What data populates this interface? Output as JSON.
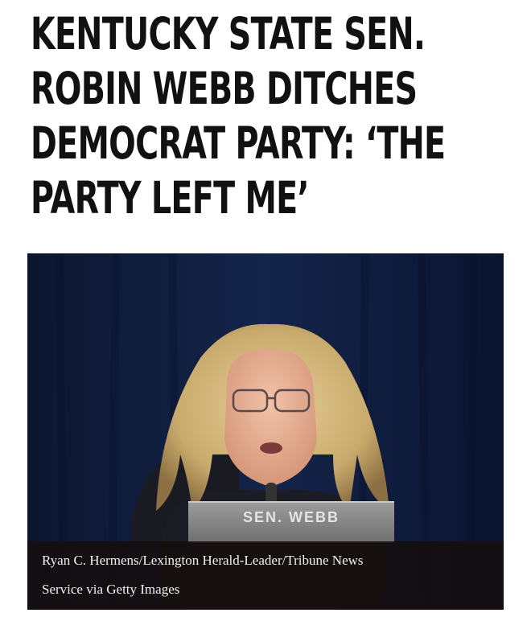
{
  "article": {
    "headline_lines": [
      "KENTUCKY STATE SEN.",
      "ROBIN WEBB DITCHES",
      "DEMOCRAT PARTY: ‘THE",
      "PARTY LEFT ME’"
    ]
  },
  "photo": {
    "nameplate": "SEN. WEBB",
    "caption_lines": [
      "Ryan C. Hermens/Lexington Herald-Leader/Tribune News",
      "Service via Getty Images"
    ]
  },
  "colors": {
    "headline_text": "#111111",
    "background_curtain": "#0f1a33",
    "caption_bar": "#140e0e"
  }
}
